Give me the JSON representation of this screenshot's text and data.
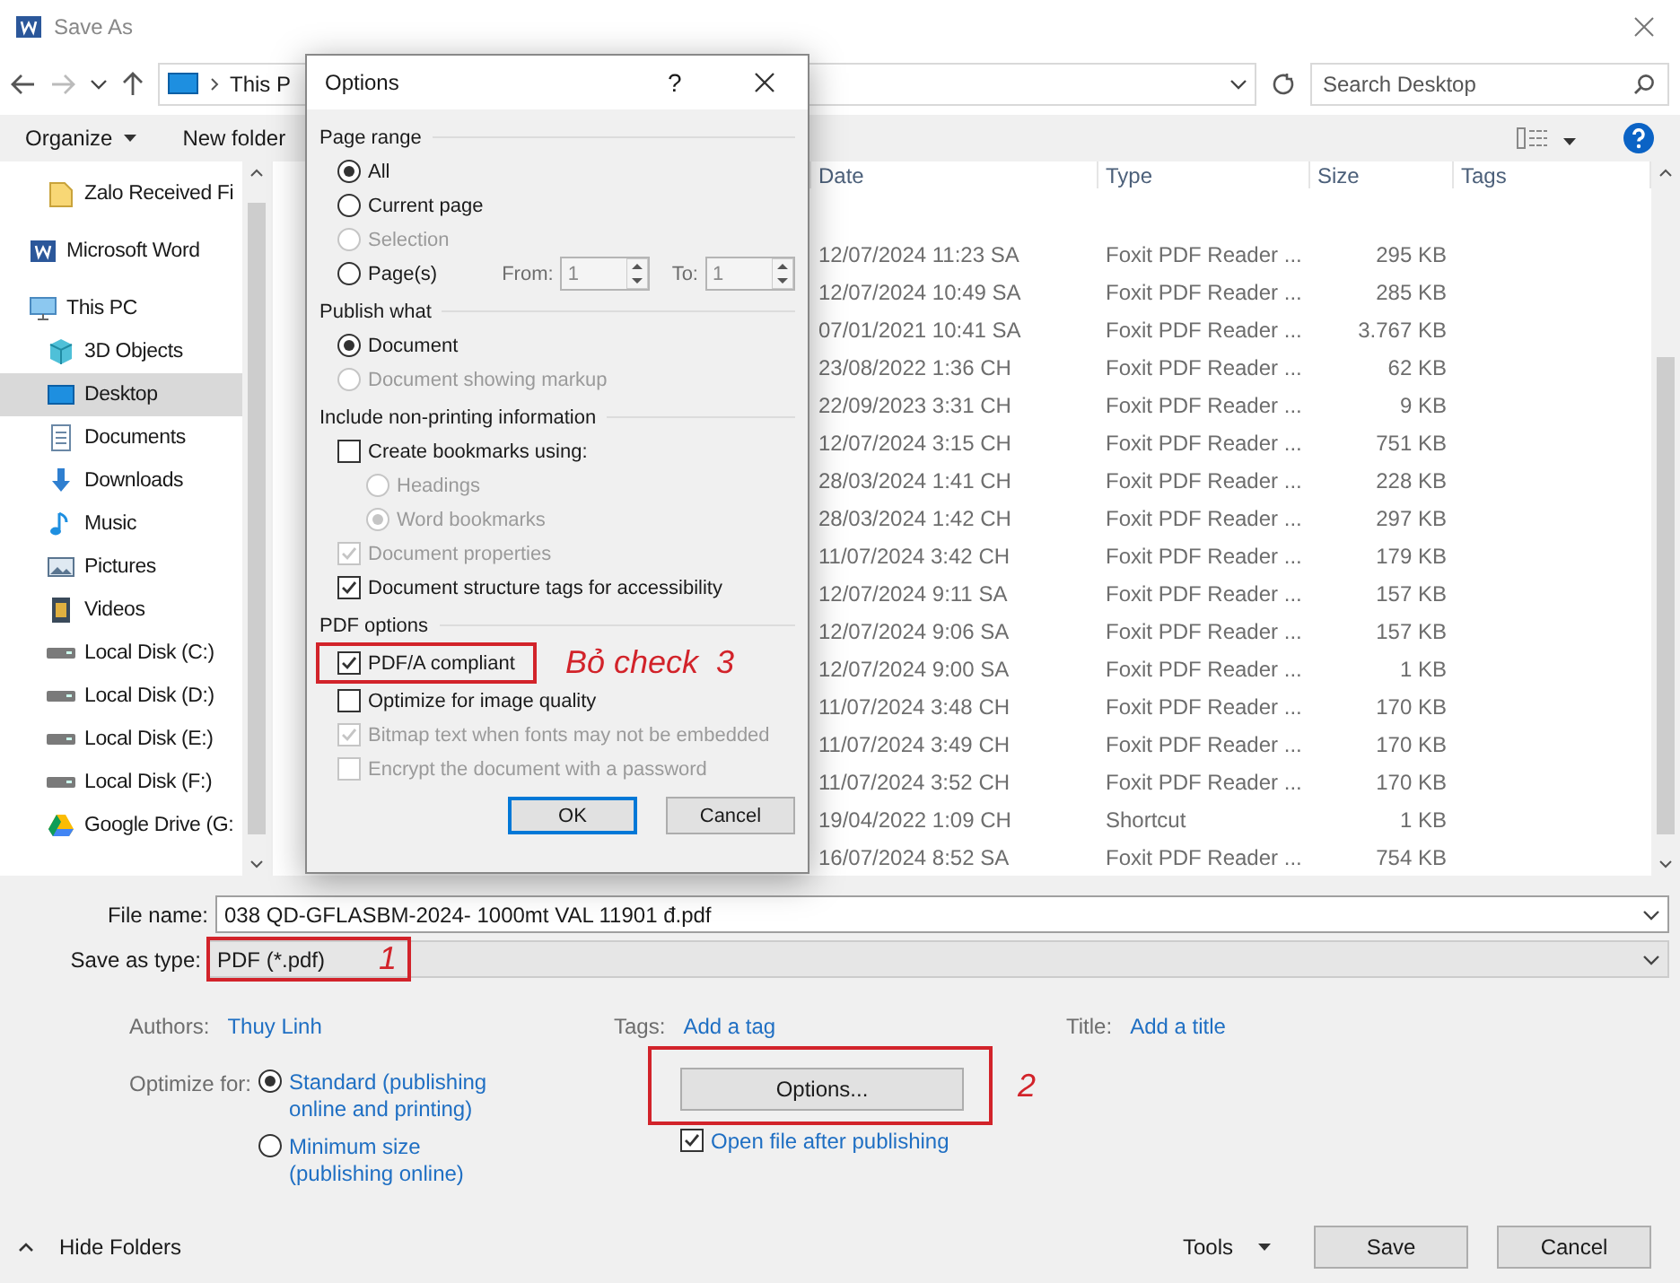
{
  "window": {
    "title": "Save As"
  },
  "address": {
    "path": "This P"
  },
  "search": {
    "placeholder": "Search Desktop"
  },
  "toolbar": {
    "organize": "Organize",
    "new_folder": "New folder"
  },
  "sidebar": {
    "scrolled_items": [
      {
        "label": "Zalo Received Fi",
        "kind": "folder",
        "selected": false
      }
    ],
    "items": [
      {
        "label": "Microsoft Word",
        "kind": "word",
        "selected": false
      },
      {
        "label": "This PC",
        "kind": "pc",
        "selected": false,
        "children": [
          {
            "label": "3D Objects",
            "kind": "cube",
            "selected": false
          },
          {
            "label": "Desktop",
            "kind": "desktop",
            "selected": true
          },
          {
            "label": "Documents",
            "kind": "doc",
            "selected": false
          },
          {
            "label": "Downloads",
            "kind": "download",
            "selected": false
          },
          {
            "label": "Music",
            "kind": "music",
            "selected": false
          },
          {
            "label": "Pictures",
            "kind": "picture",
            "selected": false
          },
          {
            "label": "Videos",
            "kind": "video",
            "selected": false
          },
          {
            "label": "Local Disk (C:)",
            "kind": "disk",
            "selected": false
          },
          {
            "label": "Local Disk (D:)",
            "kind": "disk",
            "selected": false
          },
          {
            "label": "Local Disk (E:)",
            "kind": "disk",
            "selected": false
          },
          {
            "label": "Local Disk (F:)",
            "kind": "disk",
            "selected": false
          },
          {
            "label": "Google Drive (G:",
            "kind": "gdrive",
            "selected": false
          }
        ]
      }
    ]
  },
  "file_list": {
    "columns": [
      "Date",
      "Type",
      "Size",
      "Tags"
    ],
    "rows": [
      {
        "date": "12/07/2024 11:23 SA",
        "type": "Foxit PDF Reader ...",
        "size": "295 KB"
      },
      {
        "date": "12/07/2024 10:49 SA",
        "type": "Foxit PDF Reader ...",
        "size": "285 KB"
      },
      {
        "date": "07/01/2021 10:41 SA",
        "type": "Foxit PDF Reader ...",
        "size": "3.767 KB"
      },
      {
        "date": "23/08/2022 1:36 CH",
        "type": "Foxit PDF Reader ...",
        "size": "62 KB"
      },
      {
        "date": "22/09/2023 3:31 CH",
        "type": "Foxit PDF Reader ...",
        "size": "9 KB"
      },
      {
        "date": "12/07/2024 3:15 CH",
        "type": "Foxit PDF Reader ...",
        "size": "751 KB"
      },
      {
        "date": "28/03/2024 1:41 CH",
        "type": "Foxit PDF Reader ...",
        "size": "228 KB"
      },
      {
        "date": "28/03/2024 1:42 CH",
        "type": "Foxit PDF Reader ...",
        "size": "297 KB"
      },
      {
        "date": "11/07/2024 3:42 CH",
        "type": "Foxit PDF Reader ...",
        "size": "179 KB"
      },
      {
        "date": "12/07/2024 9:11 SA",
        "type": "Foxit PDF Reader ...",
        "size": "157 KB"
      },
      {
        "date": "12/07/2024 9:06 SA",
        "type": "Foxit PDF Reader ...",
        "size": "157 KB"
      },
      {
        "date": "12/07/2024 9:00 SA",
        "type": "Foxit PDF Reader ...",
        "size": "1 KB"
      },
      {
        "date": "11/07/2024 3:48 CH",
        "type": "Foxit PDF Reader ...",
        "size": "170 KB"
      },
      {
        "date": "11/07/2024 3:49 CH",
        "type": "Foxit PDF Reader ...",
        "size": "170 KB"
      },
      {
        "date": "11/07/2024 3:52 CH",
        "type": "Foxit PDF Reader ...",
        "size": "170 KB"
      },
      {
        "date": "19/04/2022 1:09 CH",
        "type": "Shortcut",
        "size": "1 KB"
      },
      {
        "date": "16/07/2024 8:52 SA",
        "type": "Foxit PDF Reader ...",
        "size": "754 KB"
      }
    ]
  },
  "dialog": {
    "title": "Options",
    "help": "?",
    "sections": [
      {
        "title": "Page range",
        "options": [
          {
            "kind": "radio",
            "label": "All",
            "selected": true,
            "disabled": false
          },
          {
            "kind": "radio",
            "label": "Current page",
            "selected": false,
            "disabled": false
          },
          {
            "kind": "radio",
            "label": "Selection",
            "selected": false,
            "disabled": true
          },
          {
            "kind": "radio",
            "label": "Page(s)",
            "selected": false,
            "disabled": false,
            "from_label": "From:",
            "from_value": "1",
            "to_label": "To:",
            "to_value": "1"
          }
        ]
      },
      {
        "title": "Publish what",
        "options": [
          {
            "kind": "radio",
            "label": "Document",
            "selected": true,
            "disabled": false
          },
          {
            "kind": "radio",
            "label": "Document showing markup",
            "selected": false,
            "disabled": true
          }
        ]
      },
      {
        "title": "Include non-printing information",
        "options": [
          {
            "kind": "checkbox",
            "label": "Create bookmarks using:",
            "checked": false,
            "disabled": false,
            "children": [
              {
                "kind": "radio",
                "label": "Headings",
                "selected": false,
                "disabled": true
              },
              {
                "kind": "radio",
                "label": "Word bookmarks",
                "selected": true,
                "disabled": true
              }
            ]
          },
          {
            "kind": "checkbox",
            "label": "Document properties",
            "checked": true,
            "disabled": true
          },
          {
            "kind": "checkbox",
            "label": "Document structure tags for accessibility",
            "checked": true,
            "disabled": false
          }
        ]
      },
      {
        "title": "PDF options",
        "options": [
          {
            "kind": "checkbox",
            "label": "PDF/A compliant",
            "checked": true,
            "disabled": false,
            "callout": "Bỏ check  3"
          },
          {
            "kind": "checkbox",
            "label": "Optimize for image quality",
            "checked": false,
            "disabled": false
          },
          {
            "kind": "checkbox",
            "label": "Bitmap text when fonts may not be embedded",
            "checked": true,
            "disabled": true
          },
          {
            "kind": "checkbox",
            "label": "Encrypt the document with a password",
            "checked": false,
            "disabled": true
          }
        ]
      }
    ],
    "buttons": [
      "OK",
      "Cancel"
    ]
  },
  "form": {
    "file_name_label": "File name:",
    "file_name": "038 QD-GFLASBM-2024- 1000mt VAL 11901 đ.pdf",
    "type_label": "Save as type:",
    "type_value": "PDF (*.pdf)",
    "type_callout": "1",
    "authors_label": "Authors:",
    "authors": "Thuy Linh",
    "tags_label": "Tags:",
    "tags": "Add a tag",
    "title_label": "Title:",
    "title": "Add a title",
    "optimize_label": "Optimize for:",
    "optimize_options": [
      {
        "label": "Standard (publishing online and printing)",
        "selected": true
      },
      {
        "label": "Minimum size (publishing online)",
        "selected": false
      }
    ],
    "options_button": "Options...",
    "options_callout": "2",
    "open_after": {
      "label": "Open file after publishing",
      "checked": true
    }
  },
  "footer": {
    "hide_folders": "Hide Folders",
    "tools": "Tools",
    "save": "Save",
    "cancel": "Cancel"
  }
}
